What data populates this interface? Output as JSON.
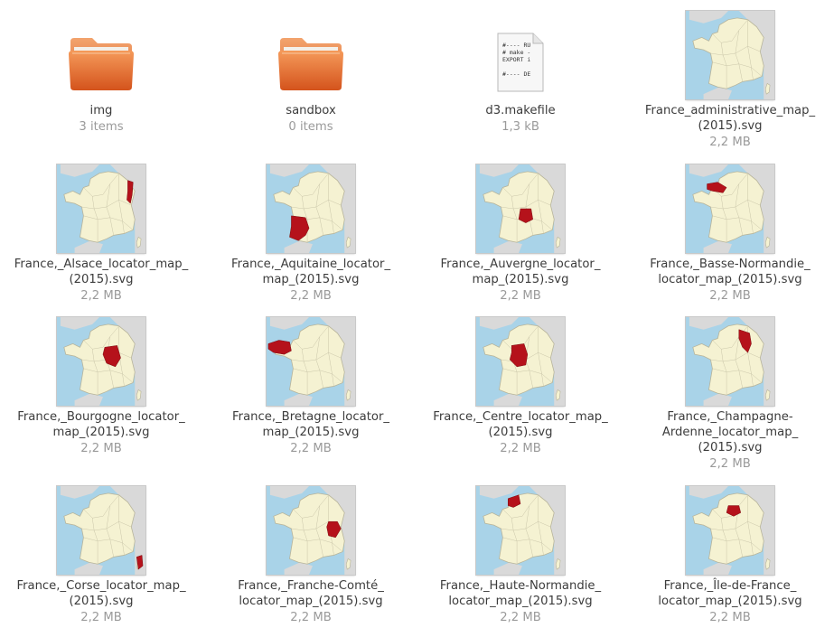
{
  "files": [
    {
      "kind": "folder",
      "name": "img",
      "meta": "3 items"
    },
    {
      "kind": "folder",
      "name": "sandbox",
      "meta": "0 items"
    },
    {
      "kind": "text",
      "name": "d3.makefile",
      "meta": "1,3 kB",
      "preview": [
        "#---- RU",
        "# make -",
        "EXPORT i",
        "",
        "#---- DE"
      ]
    },
    {
      "kind": "map",
      "name": "France_administrative_map_\n(2015).svg",
      "meta": "2,2 MB",
      "region": "none"
    },
    {
      "kind": "map",
      "name": "France,_Alsace_locator_map_\n(2015).svg",
      "meta": "2,2 MB",
      "region": "alsace"
    },
    {
      "kind": "map",
      "name": "France,_Aquitaine_locator_\nmap_(2015).svg",
      "meta": "2,2 MB",
      "region": "aquitaine"
    },
    {
      "kind": "map",
      "name": "France,_Auvergne_locator_\nmap_(2015).svg",
      "meta": "2,2 MB",
      "region": "auvergne"
    },
    {
      "kind": "map",
      "name": "France,_Basse-Normandie_\nlocator_map_(2015).svg",
      "meta": "2,2 MB",
      "region": "basse-normandie"
    },
    {
      "kind": "map",
      "name": "France,_Bourgogne_locator_\nmap_(2015).svg",
      "meta": "2,2 MB",
      "region": "bourgogne"
    },
    {
      "kind": "map",
      "name": "France,_Bretagne_locator_\nmap_(2015).svg",
      "meta": "2,2 MB",
      "region": "bretagne"
    },
    {
      "kind": "map",
      "name": "France,_Centre_locator_map_\n(2015).svg",
      "meta": "2,2 MB",
      "region": "centre"
    },
    {
      "kind": "map",
      "name": "France,_Champagne-\nArdenne_locator_map_\n(2015).svg",
      "meta": "2,2 MB",
      "region": "champagne-ardenne"
    },
    {
      "kind": "map",
      "name": "France,_Corse_locator_map_\n(2015).svg",
      "meta": "2,2 MB",
      "region": "corse"
    },
    {
      "kind": "map",
      "name": "France,_Franche-Comté_\nlocator_map_(2015).svg",
      "meta": "2,2 MB",
      "region": "franche-comte"
    },
    {
      "kind": "map",
      "name": "France,_Haute-Normandie_\nlocator_map_(2015).svg",
      "meta": "2,2 MB",
      "region": "haute-normandie"
    },
    {
      "kind": "map",
      "name": "France,_Île-de-France_\nlocator_map_(2015).svg",
      "meta": "2,2 MB",
      "region": "ile-de-france"
    }
  ],
  "colors": {
    "highlight": "#b5121b",
    "land": "#f5f2d2",
    "sea": "#a9d3e8",
    "foreign": "#d6d6d6",
    "folder": "#e8682a"
  }
}
